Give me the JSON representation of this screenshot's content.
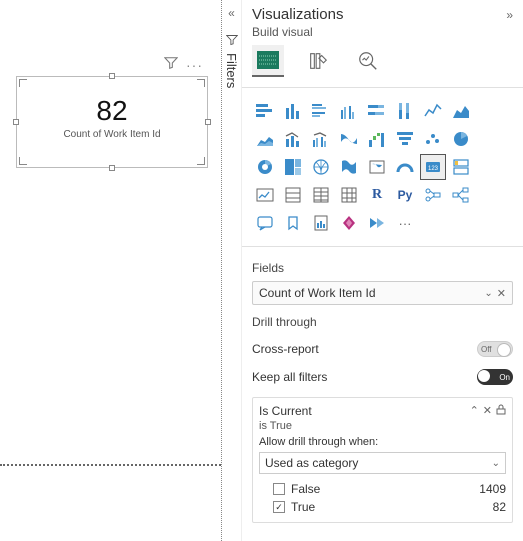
{
  "canvas": {
    "card_value": "82",
    "card_label": "Count of Work Item Id"
  },
  "filters_pane": {
    "label": "Filters"
  },
  "viz": {
    "title": "Visualizations",
    "build_label": "Build visual"
  },
  "fields": {
    "header": "Fields",
    "well_value": "Count of Work Item Id"
  },
  "drill": {
    "header": "Drill through",
    "cross_report": "Cross-report",
    "cross_report_state": "Off",
    "keep_filters": "Keep all filters",
    "keep_filters_state": "On",
    "filter_name": "Is Current",
    "filter_summary": "is True",
    "allow_label": "Allow drill through when:",
    "select_value": "Used as category",
    "values": [
      {
        "label": "False",
        "count": "1409",
        "checked": false
      },
      {
        "label": "True",
        "count": "82",
        "checked": true
      }
    ]
  }
}
